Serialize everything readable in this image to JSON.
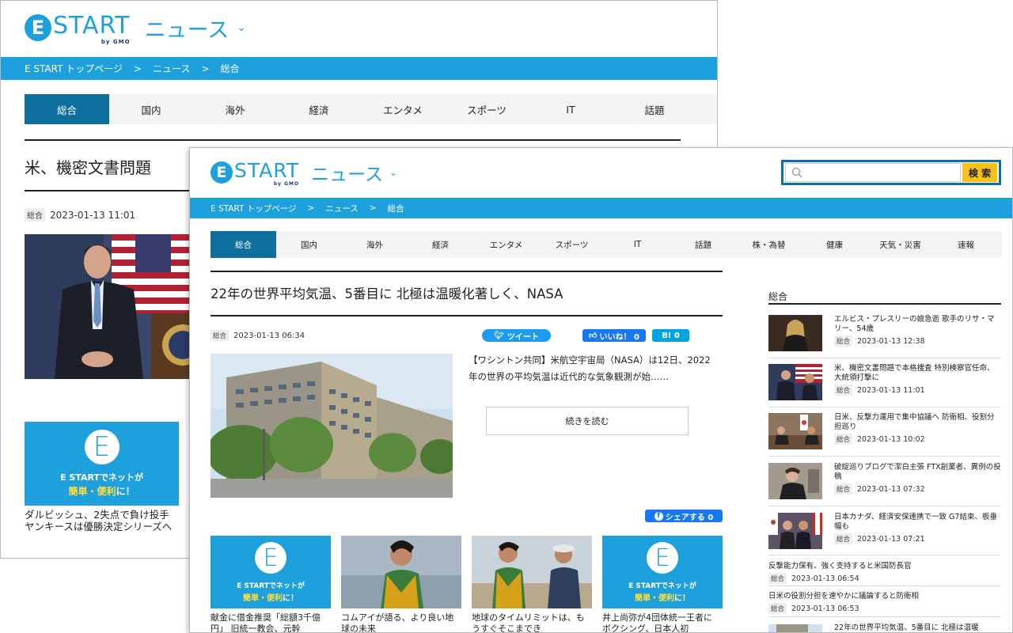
{
  "back": {
    "logo": {
      "e": "E",
      "start": "START",
      "gmo": "by GMO",
      "news": "ニュース"
    },
    "breadcrumb": [
      "E START トップページ",
      ">",
      "ニュース",
      ">",
      "総合"
    ],
    "tabs": [
      "総合",
      "国内",
      "海外",
      "経済",
      "エンタメ",
      "スポーツ",
      "IT",
      "話題"
    ],
    "headline": "米、機密文書問題",
    "category": "総合",
    "date": "2023-01-13 11:01",
    "promo": {
      "e": "E",
      "line1": "E STARTでネットが",
      "line2a": "簡単・便利",
      "line2b": "に！"
    },
    "card_title": "ダルビッシュ、2失点で負け投手 ヤンキースは優勝決定シリーズへ"
  },
  "front": {
    "logo": {
      "e": "E",
      "start": "START",
      "gmo": "by GMO",
      "news": "ニュース"
    },
    "search": {
      "placeholder": "",
      "button": "検 索"
    },
    "breadcrumb": [
      "E START トップページ",
      ">",
      "ニュース",
      ">",
      "総合"
    ],
    "tabs": [
      "総合",
      "国内",
      "海外",
      "経済",
      "エンタメ",
      "スポーツ",
      "IT",
      "話題",
      "株・為替",
      "健康",
      "天気・災害",
      "速報"
    ],
    "article": {
      "title": "22年の世界平均気温、5番目に 北極は温暖化著しく、NASA",
      "category": "総合",
      "date": "2023-01-13 06:34",
      "tweet": "ツイート",
      "like": "いいね！ 0",
      "hatena": "B! 0",
      "body": "【ワシントン共同】米航空宇宙局（NASA）は12日、2022年の世界の平均気温は近代的な気象観測が始……",
      "read_more": "続きを読む",
      "share": "シェアする 0"
    },
    "cards": [
      {
        "title": "献金に借金推奨「総額3千億円」 旧統一教会、元幹"
      },
      {
        "title": "コムアイが語る、より良い地球の未来"
      },
      {
        "title": "地球のタイムリミットは、もうすぐそこまでき"
      },
      {
        "title": "井上尚弥が4団体統一王者に ボクシング、日本人初"
      }
    ],
    "promo": {
      "e": "E",
      "line1": "E STARTでネットが",
      "line2a": "簡単・便利",
      "line2b": "に！"
    },
    "sidebar": {
      "heading": "総合",
      "items": [
        {
          "title": "エルビス・プレスリーの娘急逝 歌手のリサ・マリー、54歳",
          "cat": "総合",
          "date": "2023-01-13 12:38"
        },
        {
          "title": "米、機密文書問題で本格捜査 特別検察官任命、大統領打撃に",
          "cat": "総合",
          "date": "2023-01-13 11:01"
        },
        {
          "title": "日米、反撃力運用で集中協議へ 防衛相、役割分担巡り",
          "cat": "総合",
          "date": "2023-01-13 10:02"
        },
        {
          "title": "破綻巡りブログで潔白主張 FTX創業者、異例の投稿",
          "cat": "総合",
          "date": "2023-01-13 07:32"
        },
        {
          "title": "日本カナダ、経済安保連携で一致 G7結束、板垂幅も",
          "cat": "総合",
          "date": "2023-01-13 07:21"
        },
        {
          "title": "反撃能力保有、強く支持すると米国防長官",
          "cat": "総合",
          "date": "2023-01-13 06:54"
        },
        {
          "title": "日米の役割分担を速やかに議論すると防衛相",
          "cat": "総合",
          "date": "2023-01-13 06:53"
        },
        {
          "title": "22年の世界平均気温、5番目に 北極は温暖",
          "cat": "",
          "date": ""
        }
      ]
    }
  }
}
